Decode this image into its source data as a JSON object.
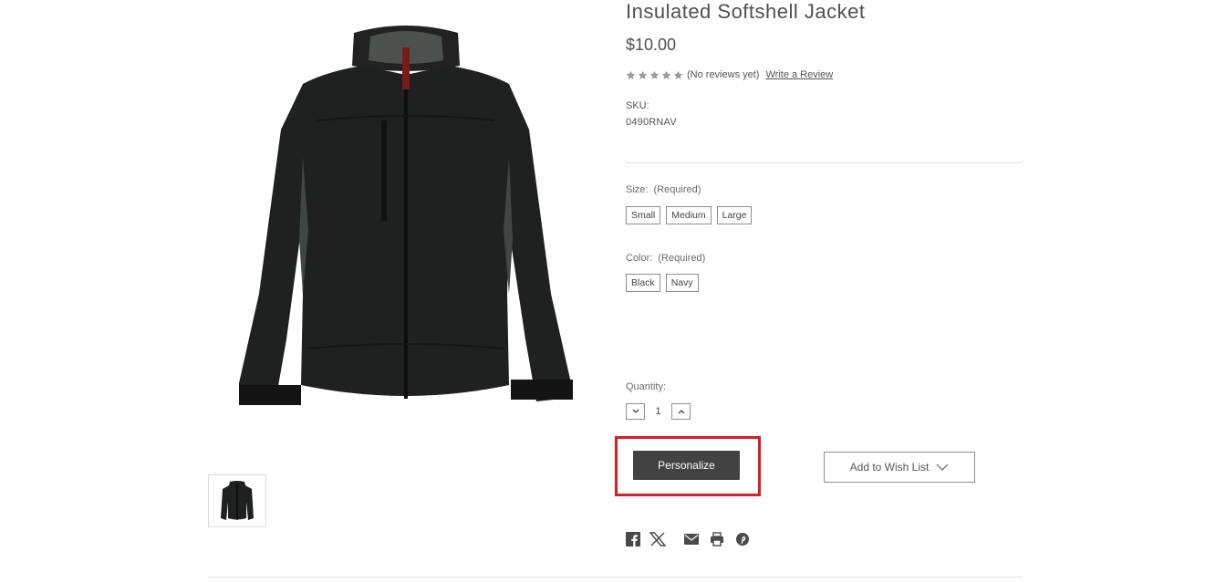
{
  "product": {
    "title": "Insulated Softshell Jacket",
    "price": "$10.00",
    "rating": {
      "stars_filled": 0,
      "stars_total": 5,
      "reviews_text": "(No reviews yet)",
      "write_review": "Write a Review"
    },
    "sku_label": "SKU:",
    "sku_value": "0490RNAV"
  },
  "options": {
    "size": {
      "label": "Size:",
      "required": "(Required)",
      "values": [
        "Small",
        "Medium",
        "Large"
      ]
    },
    "color": {
      "label": "Color:",
      "required": "(Required)",
      "values": [
        "Black",
        "Navy"
      ]
    }
  },
  "quantity": {
    "label": "Quantity:",
    "value": "1"
  },
  "actions": {
    "personalize": "Personalize",
    "wishlist": "Add to Wish List"
  },
  "social_icons": [
    "facebook-icon",
    "x-icon",
    "email-icon",
    "print-icon",
    "pinterest-icon"
  ],
  "colors": {
    "highlight": "#e11b22",
    "button_dark": "#424242",
    "star": "#9b9b9b"
  }
}
